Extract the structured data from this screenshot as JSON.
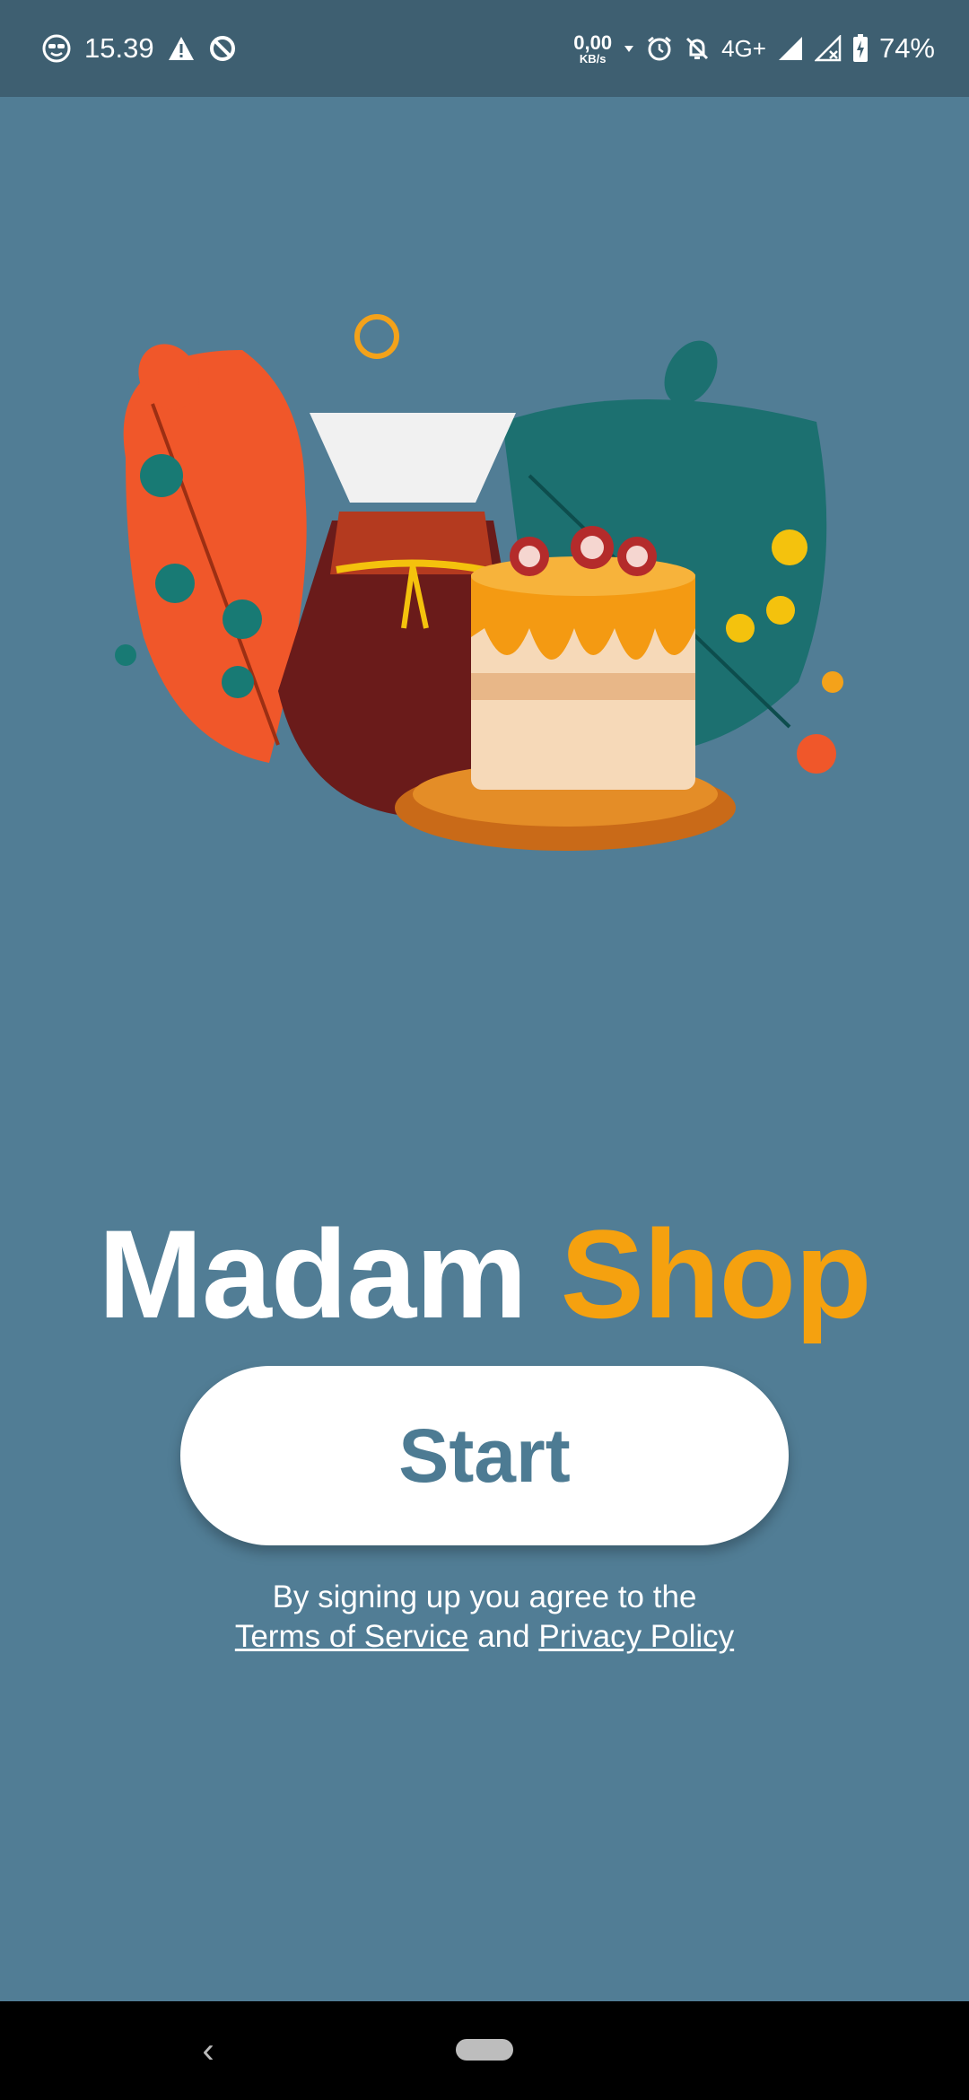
{
  "status_bar": {
    "time": "15.39",
    "net_speed_value": "0,00",
    "net_speed_unit": "KB/s",
    "network_type": "4G+",
    "battery": "74%"
  },
  "hero": {
    "icon": "coffee-and-cake-illustration"
  },
  "brand": {
    "word1": "Madam",
    "word2": "Shop",
    "accent_color": "#f5a10f"
  },
  "start_button": {
    "label": "Start"
  },
  "terms": {
    "line1": "By signing up you agree to the",
    "terms_link": "Terms of Service",
    "conjunction": "and",
    "privacy_link": "Privacy Policy"
  },
  "nav": {
    "back_icon": "‹"
  },
  "colors": {
    "background": "#517d95",
    "status_bar": "#3e5f71"
  }
}
